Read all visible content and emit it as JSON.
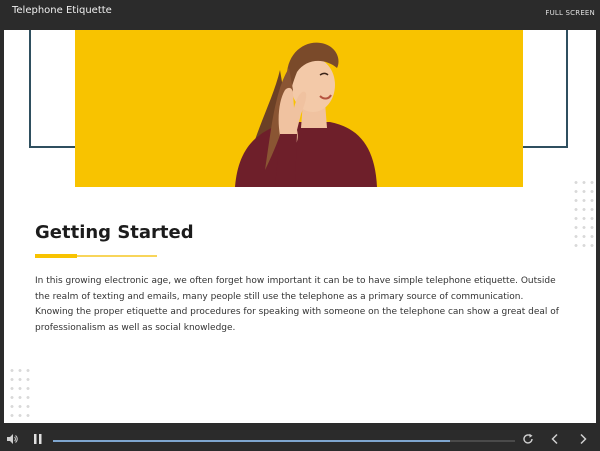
{
  "header": {
    "title": "Telephone Etiquette",
    "fullscreen_label": "FULL SCREEN"
  },
  "slide": {
    "heading": "Getting Started",
    "body": "In this growing electronic age, we often forget how important it can be to have simple telephone etiquette. Outside the realm of texting and emails, many people still use the telephone as a primary source of communication. Knowing the proper etiquette and procedures for speaking with someone on the telephone can show a great deal of professionalism as well as social knowledge.",
    "hero_color": "#f8c300",
    "accent_color": "#f8c300"
  },
  "player": {
    "progress_fraction": 0.86,
    "icons": [
      "volume-icon",
      "pause-icon",
      "replay-icon",
      "previous-icon",
      "next-icon"
    ]
  }
}
